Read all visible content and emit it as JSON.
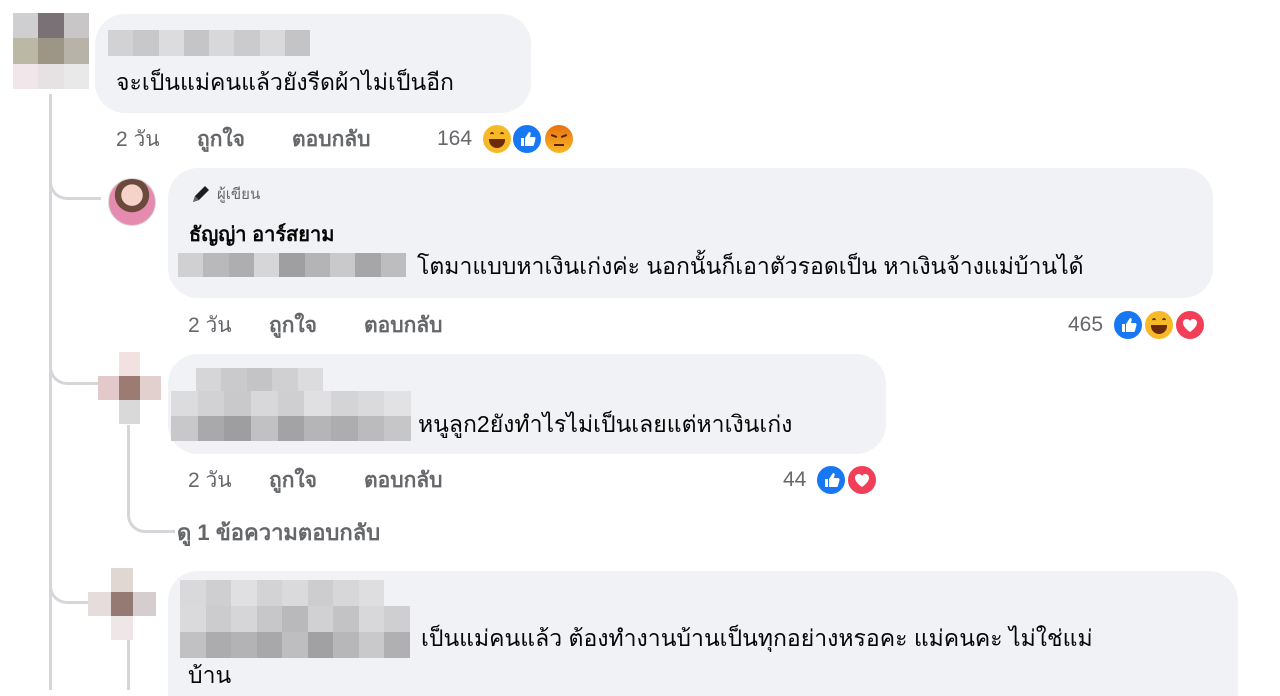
{
  "comments": [
    {
      "text": "จะเป็นแม่คนแล้วยังรีดผ้าไม่เป็นอีก",
      "time": "2 วัน",
      "like": "ถูกใจ",
      "reply": "ตอบกลับ",
      "reaction_count": "164",
      "reactions": [
        "haha-icon",
        "like-icon",
        "angry-icon"
      ]
    },
    {
      "author_badge": "ผู้เขียน",
      "author_name": "ธัญญ่า อาร์สยาม",
      "text": "โตมาแบบหาเงินเก่งค่ะ นอกนั้นก็เอาตัวรอดเป็น หาเงินจ้างแม่บ้านได้",
      "time": "2 วัน",
      "like": "ถูกใจ",
      "reply": "ตอบกลับ",
      "reaction_count": "465",
      "reactions": [
        "like-icon",
        "haha-icon",
        "love-icon"
      ]
    },
    {
      "text": "หนูลูก2ยังทำไรไม่เป็นเลยแต่หาเงินเก่ง",
      "time": "2 วัน",
      "like": "ถูกใจ",
      "reply": "ตอบกลับ",
      "reaction_count": "44",
      "reactions": [
        "like-icon",
        "love-icon"
      ],
      "view_replies": "ดู 1 ข้อความตอบกลับ"
    },
    {
      "text_line1": "เป็นแม่คนแล้ว ต้องทำงานบ้านเป็นทุกอย่างหรอคะ แม่คนคะ ไม่ใช่แม่",
      "text_line2": "บ้าน"
    }
  ],
  "colors": {
    "bubble": "#f0f2f5",
    "meta_text": "#65676b",
    "like_blue": "#1877f2",
    "love_red": "#f33e58",
    "haha_yellow": "#f7b928",
    "angry_orange": "#e9710f"
  }
}
